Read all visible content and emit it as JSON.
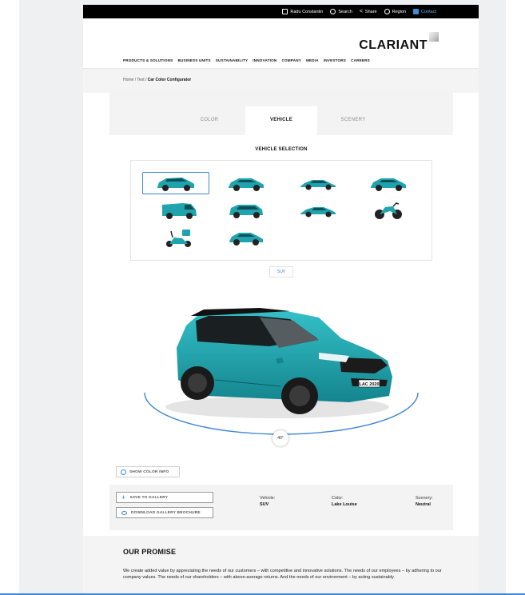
{
  "utility_bar": {
    "user": "Radu Constantin",
    "search": "Search",
    "share": "Share",
    "region": "Region",
    "contact": "Contact",
    "contact_color": "#3a8fd6"
  },
  "brand": {
    "name": "CLARIANT"
  },
  "main_nav": {
    "items": [
      "PRODUCTS & SOLUTIONS",
      "BUSINESS UNITS",
      "SUSTAINABILITY",
      "INNOVATION",
      "COMPANY",
      "MEDIA",
      "INVESTORS",
      "CAREERS"
    ]
  },
  "breadcrumb": {
    "home": "Home",
    "sep1": " / ",
    "test": "Test",
    "sep2": " / ",
    "current": "Car Color Configurator"
  },
  "tabs": [
    "COLOR",
    "VEHICLE",
    "SCENERY"
  ],
  "active_tab": "VEHICLE",
  "vehicle_selection": {
    "title": "VEHICLE SELECTION",
    "vehicles": [
      {
        "icon": "suv-icon",
        "selected": true
      },
      {
        "icon": "suv-compact-icon",
        "selected": false
      },
      {
        "icon": "sedan-icon",
        "selected": false
      },
      {
        "icon": "hatchback-icon",
        "selected": false
      },
      {
        "icon": "van-icon",
        "selected": false
      },
      {
        "icon": "minivan-icon",
        "selected": false
      },
      {
        "icon": "sports-car-icon",
        "selected": false
      },
      {
        "icon": "motorcycle-icon",
        "selected": false
      },
      {
        "icon": "scooter-icon",
        "selected": false
      },
      {
        "icon": "small-car-icon",
        "selected": false
      }
    ],
    "selected_label": "SUV",
    "vehicle_color": "#1fa4ae",
    "accent_color": "#3e86d6"
  },
  "preview": {
    "rotation_label": "40°",
    "plate": "LAC 2020"
  },
  "show_color_info": "SHOW COLOR INFO",
  "actions": {
    "save": "SAVE TO GALLERY",
    "download": "DOWNLOAD GALLERY BROCHURE"
  },
  "summary": {
    "vehicle_label": "Vehicle:",
    "vehicle_value": "SUV",
    "color_label": "Color:",
    "color_value": "Lake Louise",
    "scenery_label": "Scenery:",
    "scenery_value": "Neutral"
  },
  "promise": {
    "title": "OUR PROMISE",
    "text": "We create added value by appreciating the needs of our customers – with competitive and innovative solutions. The needs of our employees – by adhering to our company values. The needs of our shareholders – with above-average returns. And the needs of our environment – by acting sustainably."
  }
}
